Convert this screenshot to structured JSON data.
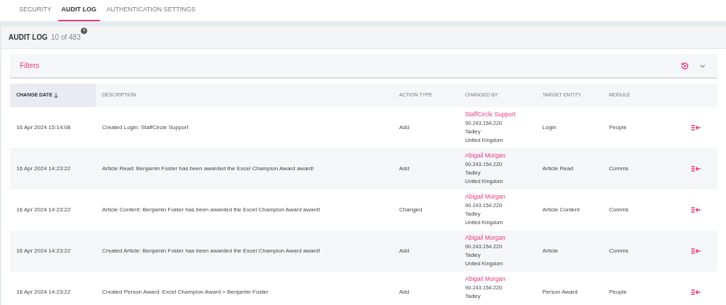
{
  "tabs": [
    {
      "label": "SECURITY",
      "selected": false
    },
    {
      "label": "AUDIT LOG",
      "selected": true
    },
    {
      "label": "AUTHENTICATION SETTINGS",
      "selected": false
    }
  ],
  "header": {
    "title": "AUDIT LOG",
    "count": "10 of 483"
  },
  "filters": {
    "label": "Filters",
    "expanded": false
  },
  "table": {
    "columns": [
      {
        "label": "CHANGE DATE",
        "sorted": true
      },
      {
        "label": "DESCRIPTION",
        "sorted": false
      },
      {
        "label": "ACTION TYPE",
        "sorted": false
      },
      {
        "label": "CHANGED BY",
        "sorted": false
      },
      {
        "label": "TARGET ENTITY",
        "sorted": false
      },
      {
        "label": "MODULE",
        "sorted": false
      }
    ],
    "rows": [
      {
        "date": "16 Apr 2024 15:14:08",
        "description": "Created Login: StaffCircle Support",
        "action": "Add",
        "changed_by": {
          "name": "StaffCircle Support",
          "details": [
            "90.243.154.220",
            "Tadley",
            "United Kingdom"
          ]
        },
        "target": "Login",
        "module": "People"
      },
      {
        "date": "16 Apr 2024 14:23:22",
        "description": "Article Read: Benjamin Foster has been awarded the Excel Champion Award award!",
        "action": "Add",
        "changed_by": {
          "name": "Abigail Morgan",
          "details": [
            "90.243.154.220",
            "Tadley",
            "United Kingdom"
          ]
        },
        "target": "Article Read",
        "module": "Comms"
      },
      {
        "date": "16 Apr 2024 14:23:22",
        "description": "Article Content: Benjamin Foster has been awarded the Excel Champion Award award!",
        "action": "Changed",
        "changed_by": {
          "name": "Abigail Morgan",
          "details": [
            "90.243.154.220",
            "Tadley",
            "United Kingdom"
          ]
        },
        "target": "Article Content",
        "module": "Comms"
      },
      {
        "date": "16 Apr 2024 14:23:22",
        "description": "Created Article: Benjamin Foster has been awarded the Excel Champion Award award!",
        "action": "Add",
        "changed_by": {
          "name": "Abigail Morgan",
          "details": [
            "90.243.154.220",
            "Tadley",
            "United Kingdom"
          ]
        },
        "target": "Article",
        "module": "Comms"
      },
      {
        "date": "16 Apr 2024 14:23:22",
        "description": "Created Person Award: Excel Champion Award > Benjamin Foster",
        "action": "Add",
        "changed_by": {
          "name": "Abigail Morgan",
          "details": [
            "90.243.154.220",
            "Tadley"
          ]
        },
        "target": "Person Award",
        "module": "People"
      }
    ]
  }
}
